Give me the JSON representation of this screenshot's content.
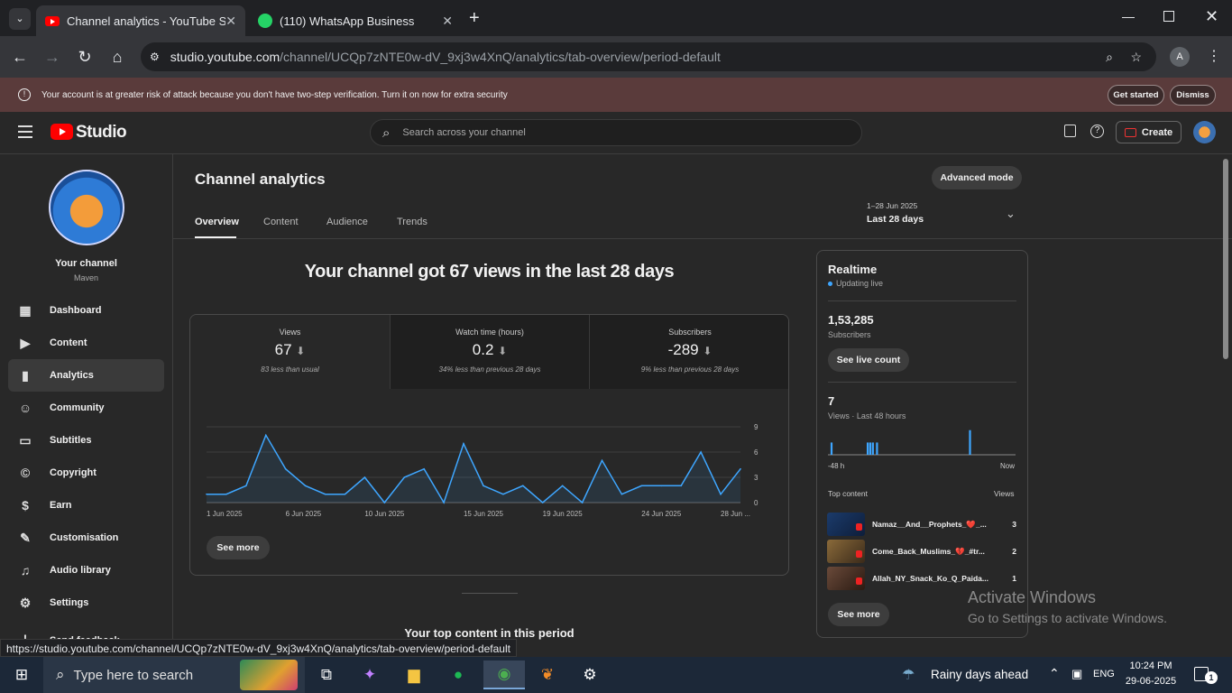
{
  "browser": {
    "tabs": [
      {
        "label": "Channel analytics - YouTube Stu",
        "active": true
      },
      {
        "label": "(110) WhatsApp Business",
        "active": false
      }
    ],
    "url_host": "studio.youtube.com",
    "url_path": "/channel/UCQp7zNTE0w-dV_9xj3w4XnQ/analytics/tab-overview/period-default",
    "profile_initial": "A",
    "status_url": "https://studio.youtube.com/channel/UCQp7zNTE0w-dV_9xj3w4XnQ/analytics/tab-overview/period-default"
  },
  "banner": {
    "text": "Your account is at greater risk of attack because you don't have two-step verification. Turn it on now for extra security",
    "get_started": "Get started",
    "dismiss": "Dismiss"
  },
  "header": {
    "logo": "Studio",
    "search_placeholder": "Search across your channel",
    "create": "Create"
  },
  "sidebar": {
    "channel_title": "Your channel",
    "channel_name": "Maven",
    "items": [
      {
        "label": "Dashboard"
      },
      {
        "label": "Content"
      },
      {
        "label": "Analytics"
      },
      {
        "label": "Community"
      },
      {
        "label": "Subtitles"
      },
      {
        "label": "Copyright"
      },
      {
        "label": "Earn"
      },
      {
        "label": "Customisation"
      },
      {
        "label": "Audio library"
      },
      {
        "label": "Settings"
      },
      {
        "label": "Send feedback"
      }
    ]
  },
  "main": {
    "title": "Channel analytics",
    "advanced_mode": "Advanced mode",
    "tabs": [
      "Overview",
      "Content",
      "Audience",
      "Trends"
    ],
    "period_range": "1–28 Jun 2025",
    "period_label": "Last 28 days",
    "headline": "Your channel got 67 views in the last 28 days",
    "metrics": [
      {
        "title": "Views",
        "value": "67",
        "sub": "83 less than usual"
      },
      {
        "title": "Watch time (hours)",
        "value": "0.2",
        "sub": "34% less than previous 28 days"
      },
      {
        "title": "Subscribers",
        "value": "-289",
        "sub": "9% less than previous 28 days"
      }
    ],
    "see_more": "See more",
    "top_content_heading": "Your top content in this period"
  },
  "chart_data": {
    "type": "area",
    "x_tick_labels": [
      "1 Jun 2025",
      "6 Jun 2025",
      "10 Jun 2025",
      "15 Jun 2025",
      "19 Jun 2025",
      "24 Jun 2025",
      "28 Jun ..."
    ],
    "y_ticks": [
      0,
      3,
      6,
      9
    ],
    "ylim": [
      0,
      9
    ],
    "values": [
      1,
      1,
      2,
      8,
      4,
      2,
      1,
      1,
      3,
      0,
      3,
      4,
      0,
      7,
      2,
      1,
      2,
      0,
      2,
      0,
      5,
      1,
      2,
      2,
      2,
      6,
      1,
      4
    ],
    "color": "#3ea6ff"
  },
  "realtime": {
    "title": "Realtime",
    "status": "Updating live",
    "subscribers": "1,53,285",
    "subscribers_label": "Subscribers",
    "see_live": "See live count",
    "views": "7",
    "views_label": "Views · Last 48 hours",
    "axis_start": "-48 h",
    "axis_end": "Now",
    "bars": [
      0,
      0,
      0,
      0,
      0,
      1,
      0,
      0,
      0,
      0,
      0,
      0,
      0,
      0,
      0,
      0,
      0,
      0,
      0,
      0,
      0,
      0,
      0,
      0,
      0,
      0,
      0,
      0,
      0,
      0,
      0,
      0,
      0,
      0,
      0,
      0,
      0,
      0,
      0,
      0,
      0,
      0,
      0,
      0,
      0,
      0,
      0,
      0,
      0,
      0,
      0,
      0,
      0,
      0,
      0,
      0,
      0,
      0,
      0,
      0,
      0,
      0,
      0,
      0,
      0,
      0,
      0,
      0,
      0,
      0,
      0,
      0,
      0,
      0,
      0,
      1,
      0,
      0,
      0,
      0,
      1,
      0,
      0,
      0,
      0,
      1,
      0,
      0,
      0,
      0,
      0,
      0,
      0,
      1,
      0,
      0,
      0,
      0,
      0,
      0,
      0,
      0,
      0,
      0,
      0,
      0,
      0,
      0,
      0,
      0,
      0,
      0,
      0,
      0,
      0,
      0,
      0,
      0,
      0,
      0,
      0,
      0,
      0,
      0,
      0,
      0,
      0,
      0,
      0,
      0,
      0,
      0,
      0,
      0,
      0,
      0,
      0,
      0,
      0,
      0,
      0,
      0,
      0,
      0,
      0,
      0,
      0,
      0,
      0,
      0,
      0,
      0,
      0,
      0,
      0,
      0,
      0,
      0,
      0,
      0,
      0,
      0,
      0,
      0,
      0,
      0,
      0,
      0,
      0,
      0,
      0,
      0,
      0,
      0,
      0,
      0,
      0,
      0,
      0,
      0,
      0,
      0,
      0,
      0,
      0,
      0,
      0,
      0,
      0,
      0,
      0,
      0,
      0,
      0,
      0,
      0,
      0,
      0,
      0,
      0,
      0,
      0,
      0,
      0,
      0,
      0,
      0,
      0,
      0,
      0,
      0,
      0,
      0,
      0,
      0,
      0,
      0,
      0,
      0,
      0,
      0,
      0,
      0,
      0,
      0,
      0,
      0,
      0,
      0,
      0,
      0,
      0,
      0,
      0,
      0,
      0,
      0,
      0,
      0,
      0,
      0,
      0,
      0,
      0,
      0,
      0,
      0,
      0,
      0,
      0,
      0,
      0,
      0,
      0,
      0,
      0,
      0,
      0,
      0,
      0,
      0,
      0,
      0,
      0,
      0,
      0,
      0,
      0,
      0,
      0,
      0,
      0,
      0,
      2,
      0,
      0,
      0,
      0,
      0,
      0,
      0,
      0,
      0,
      0,
      0,
      0,
      0,
      0,
      0,
      0,
      0,
      0,
      0,
      0,
      0,
      0,
      0,
      0,
      0,
      0,
      0,
      0,
      0,
      0,
      0,
      0,
      0,
      0,
      0,
      0,
      0,
      0,
      0,
      0,
      0,
      0,
      0,
      0,
      0,
      0,
      0,
      0,
      0,
      0,
      0,
      0,
      0,
      0,
      0,
      0,
      0,
      0,
      0,
      0,
      0,
      0,
      0,
      0,
      0,
      0,
      0,
      0,
      0,
      0,
      0,
      0,
      0,
      0,
      0,
      0,
      0,
      0,
      0,
      0,
      0,
      0,
      0,
      0,
      0,
      0,
      0,
      0,
      0
    ],
    "top_content_label": "Top content",
    "views_col": "Views",
    "top_items": [
      {
        "title": "Namaz__And__Prophets_❤️_...",
        "views": "3"
      },
      {
        "title": "Come_Back_Muslims_💔_#tr...",
        "views": "2"
      },
      {
        "title": "Allah_NY_Snack_Ko_Q_Paida...",
        "views": "1"
      }
    ],
    "see_more": "See more"
  },
  "watermark": {
    "line1": "Activate Windows",
    "line2": "Go to Settings to activate Windows."
  },
  "taskbar": {
    "search_placeholder": "Type here to search",
    "weather": "Rainy days ahead",
    "lang": "ENG",
    "time": "10:24 PM",
    "date": "29-06-2025",
    "notification_count": "1"
  }
}
